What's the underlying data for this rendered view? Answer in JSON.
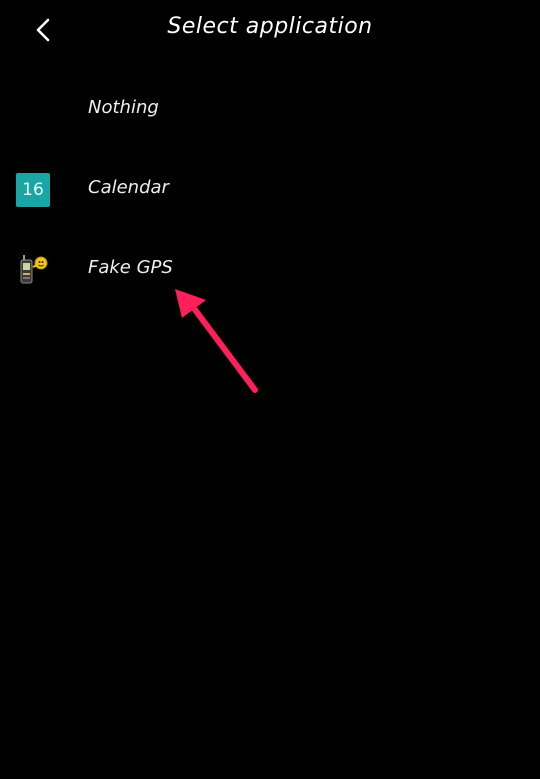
{
  "header": {
    "title": "Select application",
    "back_icon": "chevron-left-icon"
  },
  "apps": [
    {
      "label": "Nothing",
      "icon": "none"
    },
    {
      "label": "Calendar",
      "icon": "calendar-icon",
      "icon_text": "16",
      "icon_color": "#1ba6a6"
    },
    {
      "label": "Fake GPS",
      "icon": "gps-device-icon"
    }
  ],
  "annotation": {
    "type": "arrow",
    "color": "#ff1f5a",
    "points_to": "Fake GPS"
  }
}
